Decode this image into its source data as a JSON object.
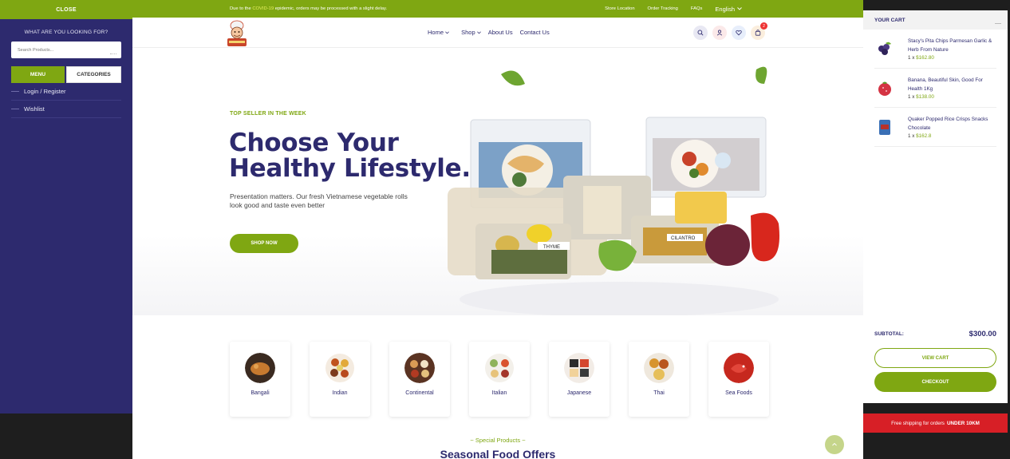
{
  "left_panel": {
    "close_label": "CLOSE",
    "search_heading": "WHAT ARE YOU LOOKING FOR?",
    "search_placeholder": "Search Products...",
    "tab_menu": "MENU",
    "tab_categories": "CATEGORIES",
    "items": [
      {
        "label": "Login / Register"
      },
      {
        "label": "Wishlist"
      }
    ]
  },
  "topbar": {
    "notice_prefix": "Due to the ",
    "notice_highlight": "COVID-19",
    "notice_suffix": " epidemic, orders may be processed with a slight delay.",
    "links": [
      "Store Location",
      "Order Tracking",
      "FAQs"
    ],
    "language": "English"
  },
  "nav": {
    "items": [
      "Home",
      "Shop",
      "About Us",
      "Contact Us"
    ],
    "cart_count": "2"
  },
  "hero": {
    "kicker": "TOP SELLER IN THE WEEK",
    "title_line1": "Choose Your",
    "title_line2": "Healthy Lifestyle.",
    "subtitle": "Presentation matters. Our fresh Vietnamese vegetable rolls look good and taste even better",
    "button": "SHOP NOW",
    "pack_labels": [
      "THYME",
      "CILANTRO"
    ]
  },
  "categories": [
    {
      "label": "Bangali"
    },
    {
      "label": "Indian"
    },
    {
      "label": "Continental"
    },
    {
      "label": "Italian"
    },
    {
      "label": "Japanese"
    },
    {
      "label": "Thai"
    },
    {
      "label": "Sea Foods"
    }
  ],
  "section": {
    "special": "~ Special Products ~",
    "title": "Seasonal Food Offers"
  },
  "cart": {
    "title": "YOUR CART",
    "items": [
      {
        "name": "Stacy's Pita Chips Parmesan Garlic & Herb From Nature",
        "qty": "1 x ",
        "price": "$162.80"
      },
      {
        "name": "Banana, Beautiful Skin, Good For Health 1Kg",
        "qty": "1 x ",
        "price": "$138.00"
      },
      {
        "name": "Quaker Popped Rice Crisps Snacks Chocolate",
        "qty": "1 x ",
        "price": "$162.8"
      }
    ],
    "subtotal_label": "SUBTOTAL:",
    "subtotal_value": "$300.00",
    "view_cart": "VIEW CART",
    "checkout": "CHECKOUT",
    "shipping_prefix": "Free shipping for orders",
    "shipping_bold": "UNDER 10KM"
  },
  "colors": {
    "accent": "#7fa712",
    "navy": "#2d2a6e",
    "red": "#d71f26"
  }
}
